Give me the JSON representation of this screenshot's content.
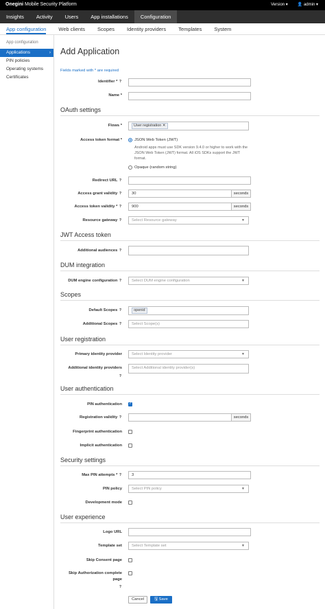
{
  "brand": {
    "bold": "Onegini",
    "rest": " Mobile Security Platform"
  },
  "topbar": {
    "version": "Version ▾",
    "user": "👤 admin ▾"
  },
  "main_nav": [
    "Insights",
    "Activity",
    "Users",
    "App installations",
    "Configuration"
  ],
  "sub_nav": [
    "App configuration",
    "Web clients",
    "Scopes",
    "Identity providers",
    "Templates",
    "System"
  ],
  "sidebar": {
    "heading": "App configuration",
    "items": [
      "Applications",
      "PIN policies",
      "Operating systems",
      "Certificates"
    ]
  },
  "page_title": "Add Application",
  "required_note": "Fields marked with * are required",
  "help_mark": "?",
  "fields": {
    "identifier": "Identifier *",
    "name": "Name *",
    "flows": "Flows *",
    "flows_tag": "User registration",
    "flows_tag_close": "✕",
    "access_token_format": "Access token format *",
    "jwt_option": "JSON Web Token (JWT)",
    "jwt_help": "Android apps must use SDK version 9.4.0 or higher to work with the JSON Web Token (JWT) format. All iOS SDKs support the JWT format.",
    "opaque_option": "Opaque (random string)",
    "redirect_url": "Redirect URL",
    "access_grant_validity": "Access grant validity",
    "access_grant_value": "30",
    "access_token_validity": "Access token validity *",
    "access_token_value": "900",
    "seconds": "seconds",
    "resource_gateway": "Resource gateway",
    "resource_gateway_ph": "Select Resource gateway",
    "additional_audiences": "Additional audiences",
    "dum_engine": "DUM engine configuration",
    "dum_engine_ph": "Select DUM engine configuration",
    "default_scopes": "Default Scopes",
    "default_scope_tag": "openid",
    "additional_scopes": "Additional Scopes",
    "additional_scopes_ph": "Select Scope(s)",
    "primary_idp": "Primary identity provider",
    "primary_idp_ph": "Select Identity provider",
    "additional_idps": "Additional identity providers",
    "additional_idps_ph": "Select Additional identity provider(s)",
    "pin_auth": "PIN authentication",
    "registration_validity": "Registration validity",
    "fingerprint_auth": "Fingerprint authentication",
    "implicit_auth": "Implicit authentication",
    "max_pin_attempts": "Max PIN attempts *",
    "max_pin_value": "3",
    "pin_policy": "PIN policy",
    "pin_policy_ph": "Select PIN policy",
    "development_mode": "Development mode",
    "logo_url": "Logo URL",
    "template_set": "Template set",
    "template_set_ph": "Select Template set",
    "skip_consent": "Skip Consent page",
    "skip_auth_complete_1": "Skip Authorization complete",
    "skip_auth_complete_2": "page"
  },
  "sections": {
    "oauth": "OAuth settings",
    "jwt": "JWT Access token",
    "dum": "DUM integration",
    "scopes": "Scopes",
    "user_registration": "User registration",
    "user_authentication": "User authentication",
    "security": "Security settings",
    "user_experience": "User experience"
  },
  "buttons": {
    "cancel": "Cancel",
    "save": "Save",
    "save_icon": "🖫"
  },
  "colors": {
    "accent": "#1a6fc6",
    "topbar": "#000000",
    "mainnav": "#2f2f2f"
  }
}
